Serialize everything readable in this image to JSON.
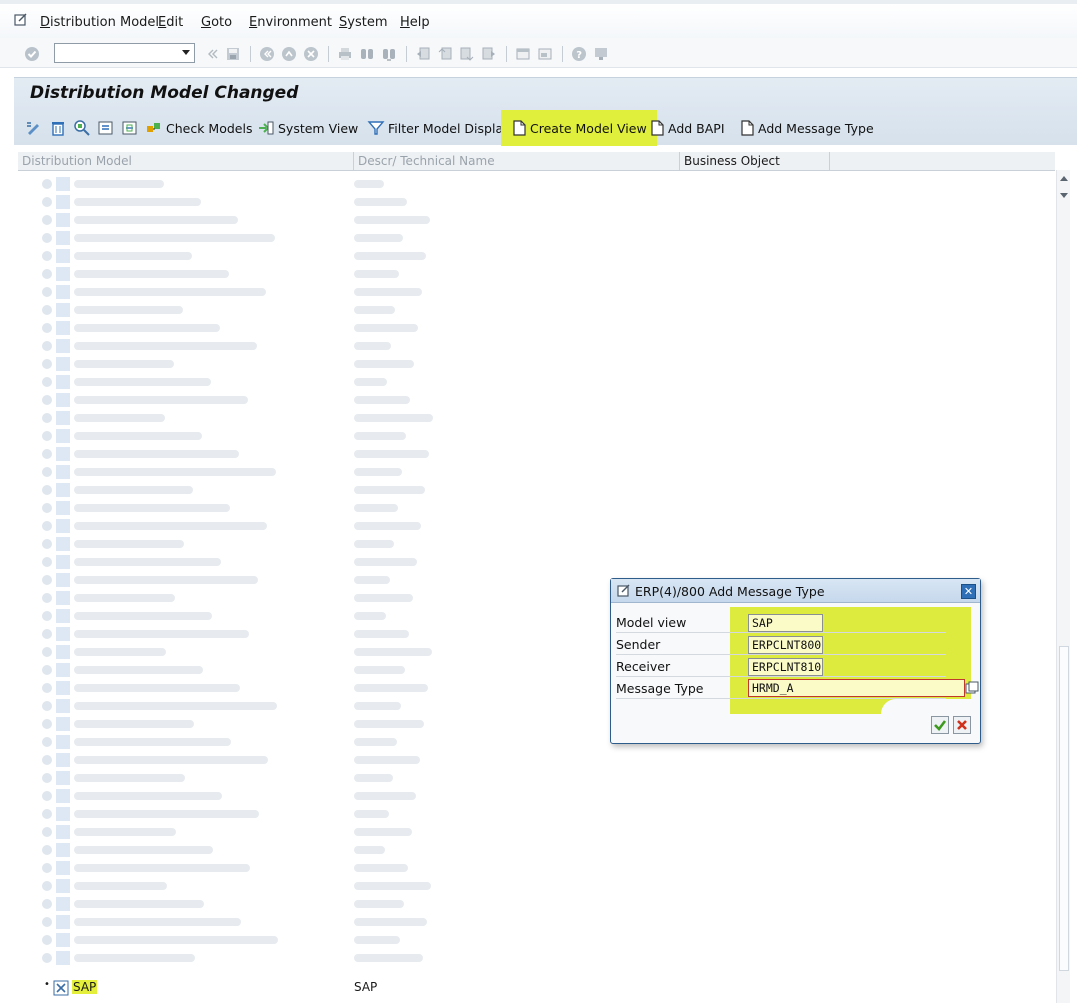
{
  "menu": {
    "items": [
      "Distribution Model",
      "Edit",
      "Goto",
      "Environment",
      "System",
      "Help"
    ]
  },
  "page": {
    "title": "Distribution Model Changed"
  },
  "app_toolbar": {
    "check_models": "Check Models",
    "system_view": "System View",
    "filter_model_display": "Filter Model Display",
    "create_model_view": "Create Model View",
    "add_bapi": "Add BAPI",
    "add_message_type": "Add Message Type"
  },
  "grid": {
    "columns": [
      "Distribution Model",
      "Descr/ Technical Name",
      "Business Object"
    ],
    "visible_row": {
      "name": "SAP",
      "technical_name": "SAP"
    }
  },
  "dialog": {
    "title": "ERP(4)/800 Add Message Type",
    "fields": [
      {
        "label": "Model view",
        "value": "SAP"
      },
      {
        "label": "Sender",
        "value": "ERPCLNT800"
      },
      {
        "label": "Receiver",
        "value": "ERPCLNT810"
      },
      {
        "label": "Message Type",
        "value": "HRMD_A"
      }
    ]
  },
  "colors": {
    "highlight": "#e0ef3c",
    "title_panel": "#d6e1ec",
    "dialog_border": "#2e5d8c"
  }
}
